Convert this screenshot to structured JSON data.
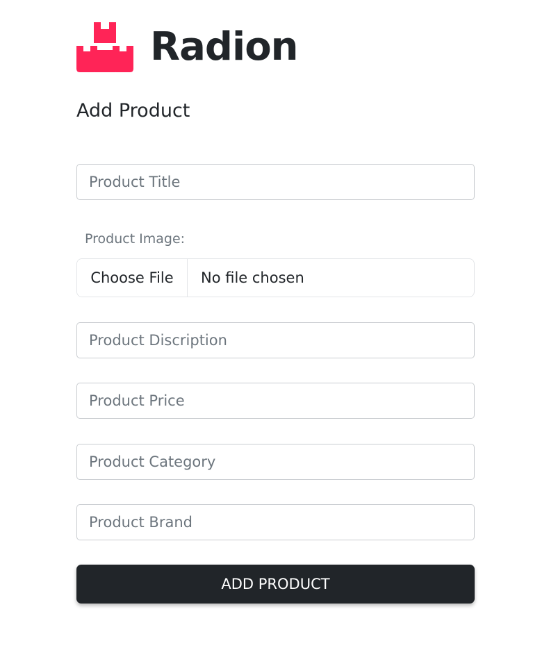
{
  "brand": {
    "name": "Radion",
    "logo_icon": "boxes-logo-icon",
    "logo_color": "#ff2457"
  },
  "form": {
    "heading": "Add Product",
    "fields": {
      "title_placeholder": "Product Title",
      "image_label": "Product Image:",
      "file_button": "Choose File",
      "file_status": "No file chosen",
      "description_placeholder": "Product Discription",
      "price_placeholder": "Product Price",
      "category_placeholder": "Product Category",
      "brand_placeholder": "Product Brand"
    },
    "submit_label": "ADD PRODUCT"
  },
  "colors": {
    "primary_dark": "#212529",
    "placeholder": "#6c757d"
  }
}
